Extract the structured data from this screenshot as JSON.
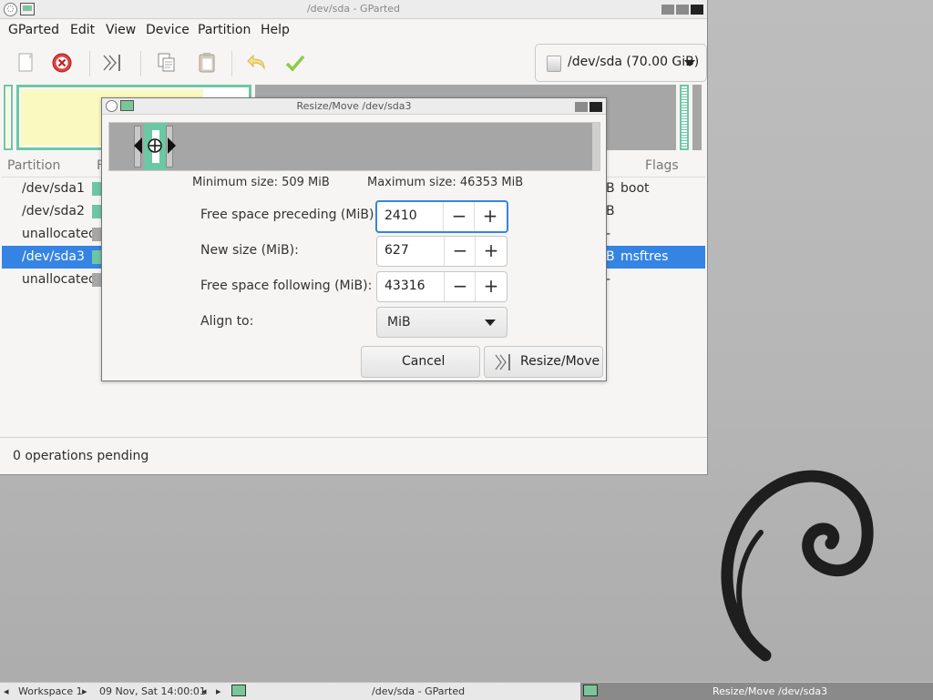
{
  "window": {
    "title": "/dev/sda - GParted",
    "menu": [
      "GParted",
      "Edit",
      "View",
      "Device",
      "Partition",
      "Help"
    ],
    "device_selector": "/dev/sda (70.00 GiB)",
    "columns": [
      "Partition",
      "F",
      "Flags"
    ],
    "partitions": [
      {
        "name": "/dev/sda1",
        "color": "#6cc7a4",
        "r1": "B",
        "flags": "boot",
        "selected": false
      },
      {
        "name": "/dev/sda2",
        "color": "#6cc7a4",
        "r1": "B",
        "flags": "",
        "selected": false
      },
      {
        "name": "unallocated",
        "color": "#a6a6a6",
        "r1": "-",
        "flags": "",
        "selected": false
      },
      {
        "name": "/dev/sda3",
        "color": "#6cc7a4",
        "r1": "B",
        "flags": "msftres",
        "selected": true
      },
      {
        "name": "unallocated",
        "color": "#a6a6a6",
        "r1": "-",
        "flags": "",
        "selected": false
      }
    ],
    "status": "0 operations pending"
  },
  "dialog": {
    "title": "Resize/Move /dev/sda3",
    "minimum_size": "Minimum size: 509 MiB",
    "maximum_size": "Maximum size: 46353 MiB",
    "fields": {
      "preceding_label": "Free space preceding (MiB):",
      "preceding_value": "2410",
      "new_size_label": "New size (MiB):",
      "new_size_value": "627",
      "following_label": "Free space following (MiB):",
      "following_value": "43316",
      "align_label": "Align to:",
      "align_value": "MiB"
    },
    "cancel": "Cancel",
    "resize_move": "Resize/Move"
  },
  "taskbar": {
    "workspace": "Workspace 1",
    "datetime": "09 Nov, Sat 14:00:01",
    "task1": "/dev/sda - GParted",
    "task2": "Resize/Move /dev/sda3"
  },
  "colors": {
    "accent": "#3584e4",
    "partition_green": "#6cc7a4",
    "unallocated": "#a6a6a6",
    "fat_yellow": "#fafac0"
  }
}
